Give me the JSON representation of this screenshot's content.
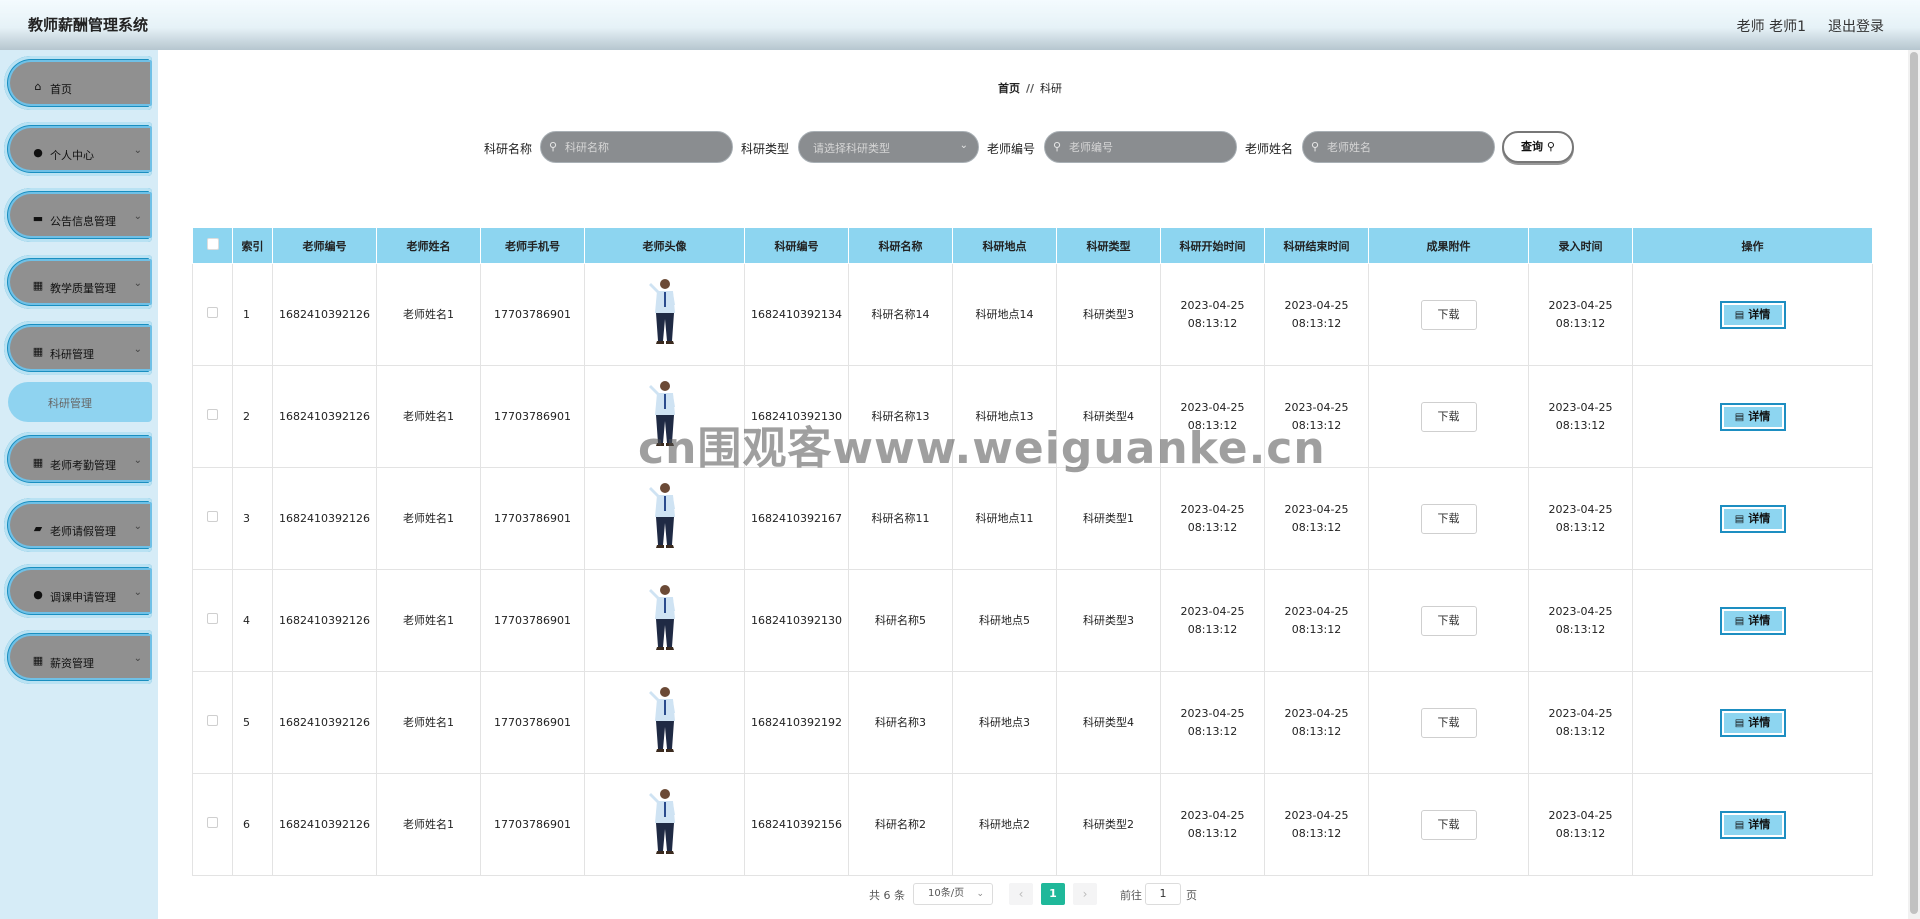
{
  "app": {
    "title": "教师薪酬管理系统",
    "user_label": "老师 老师1",
    "logout_label": "退出登录"
  },
  "sidebar": {
    "items": [
      {
        "label": "首页",
        "icon": "home-icon",
        "glyph": "⌂",
        "has_chevron": false
      },
      {
        "label": "个人中心",
        "icon": "user-icon",
        "glyph": "●",
        "has_chevron": true
      },
      {
        "label": "公告信息管理",
        "icon": "notice-icon",
        "glyph": "▬",
        "has_chevron": true
      },
      {
        "label": "教学质量管理",
        "icon": "grid-icon",
        "glyph": "▦",
        "has_chevron": true
      },
      {
        "label": "科研管理",
        "icon": "grid-icon",
        "glyph": "▦",
        "has_chevron": true
      },
      {
        "label": "老师考勤管理",
        "icon": "grid-icon",
        "glyph": "▦",
        "has_chevron": true
      },
      {
        "label": "老师请假管理",
        "icon": "briefcase-icon",
        "glyph": "▰",
        "has_chevron": true
      },
      {
        "label": "调课申请管理",
        "icon": "user-icon",
        "glyph": "●",
        "has_chevron": true
      },
      {
        "label": "薪资管理",
        "icon": "grid-icon",
        "glyph": "▦",
        "has_chevron": true
      }
    ],
    "sub_item": "科研管理"
  },
  "breadcrumb": {
    "home": "首页",
    "separator": "//",
    "current": "科研"
  },
  "search": {
    "fields": [
      {
        "label": "科研名称",
        "placeholder": "科研名称",
        "type": "input"
      },
      {
        "label": "科研类型",
        "placeholder": "请选择科研类型",
        "type": "select"
      },
      {
        "label": "老师编号",
        "placeholder": "老师编号",
        "type": "input"
      },
      {
        "label": "老师姓名",
        "placeholder": "老师姓名",
        "type": "input"
      }
    ],
    "query_label": "查询"
  },
  "table": {
    "headers": [
      "索引",
      "老师编号",
      "老师姓名",
      "老师手机号",
      "老师头像",
      "科研编号",
      "科研名称",
      "科研地点",
      "科研类型",
      "科研开始时间",
      "科研结束时间",
      "成果附件",
      "录入时间",
      "操作"
    ],
    "download_label": "下载",
    "detail_label": "详情",
    "rows": [
      {
        "index": "1",
        "teacher_no": "1682410392126",
        "teacher_name": "老师姓名1",
        "phone": "17703786901",
        "research_no": "1682410392134",
        "research_name": "科研名称14",
        "location": "科研地点14",
        "type": "科研类型3",
        "start": "2023-04-25 08:13:12",
        "end": "2023-04-25 08:13:12",
        "created": "2023-04-25 08:13:12"
      },
      {
        "index": "2",
        "teacher_no": "1682410392126",
        "teacher_name": "老师姓名1",
        "phone": "17703786901",
        "research_no": "1682410392130",
        "research_name": "科研名称13",
        "location": "科研地点13",
        "type": "科研类型4",
        "start": "2023-04-25 08:13:12",
        "end": "2023-04-25 08:13:12",
        "created": "2023-04-25 08:13:12"
      },
      {
        "index": "3",
        "teacher_no": "1682410392126",
        "teacher_name": "老师姓名1",
        "phone": "17703786901",
        "research_no": "1682410392167",
        "research_name": "科研名称11",
        "location": "科研地点11",
        "type": "科研类型1",
        "start": "2023-04-25 08:13:12",
        "end": "2023-04-25 08:13:12",
        "created": "2023-04-25 08:13:12"
      },
      {
        "index": "4",
        "teacher_no": "1682410392126",
        "teacher_name": "老师姓名1",
        "phone": "17703786901",
        "research_no": "1682410392130",
        "research_name": "科研名称5",
        "location": "科研地点5",
        "type": "科研类型3",
        "start": "2023-04-25 08:13:12",
        "end": "2023-04-25 08:13:12",
        "created": "2023-04-25 08:13:12"
      },
      {
        "index": "5",
        "teacher_no": "1682410392126",
        "teacher_name": "老师姓名1",
        "phone": "17703786901",
        "research_no": "1682410392192",
        "research_name": "科研名称3",
        "location": "科研地点3",
        "type": "科研类型4",
        "start": "2023-04-25 08:13:12",
        "end": "2023-04-25 08:13:12",
        "created": "2023-04-25 08:13:12"
      },
      {
        "index": "6",
        "teacher_no": "1682410392126",
        "teacher_name": "老师姓名1",
        "phone": "17703786901",
        "research_no": "1682410392156",
        "research_name": "科研名称2",
        "location": "科研地点2",
        "type": "科研类型2",
        "start": "2023-04-25 08:13:12",
        "end": "2023-04-25 08:13:12",
        "created": "2023-04-25 08:13:12"
      }
    ]
  },
  "pagination": {
    "total": "共 6 条",
    "page_size": "10条/页",
    "current_page": "1",
    "goto_prefix": "前往",
    "goto_value": "1",
    "goto_suffix": "页"
  },
  "watermark": "cn围观客www.weiguanke.cn",
  "colors": {
    "header_bg": "#8dd5f0",
    "menu_border": "#1a8fc0",
    "menu_fill": "#909090",
    "sidebar_bg": "#d6ecf7",
    "pager_active": "#1fb89a"
  }
}
